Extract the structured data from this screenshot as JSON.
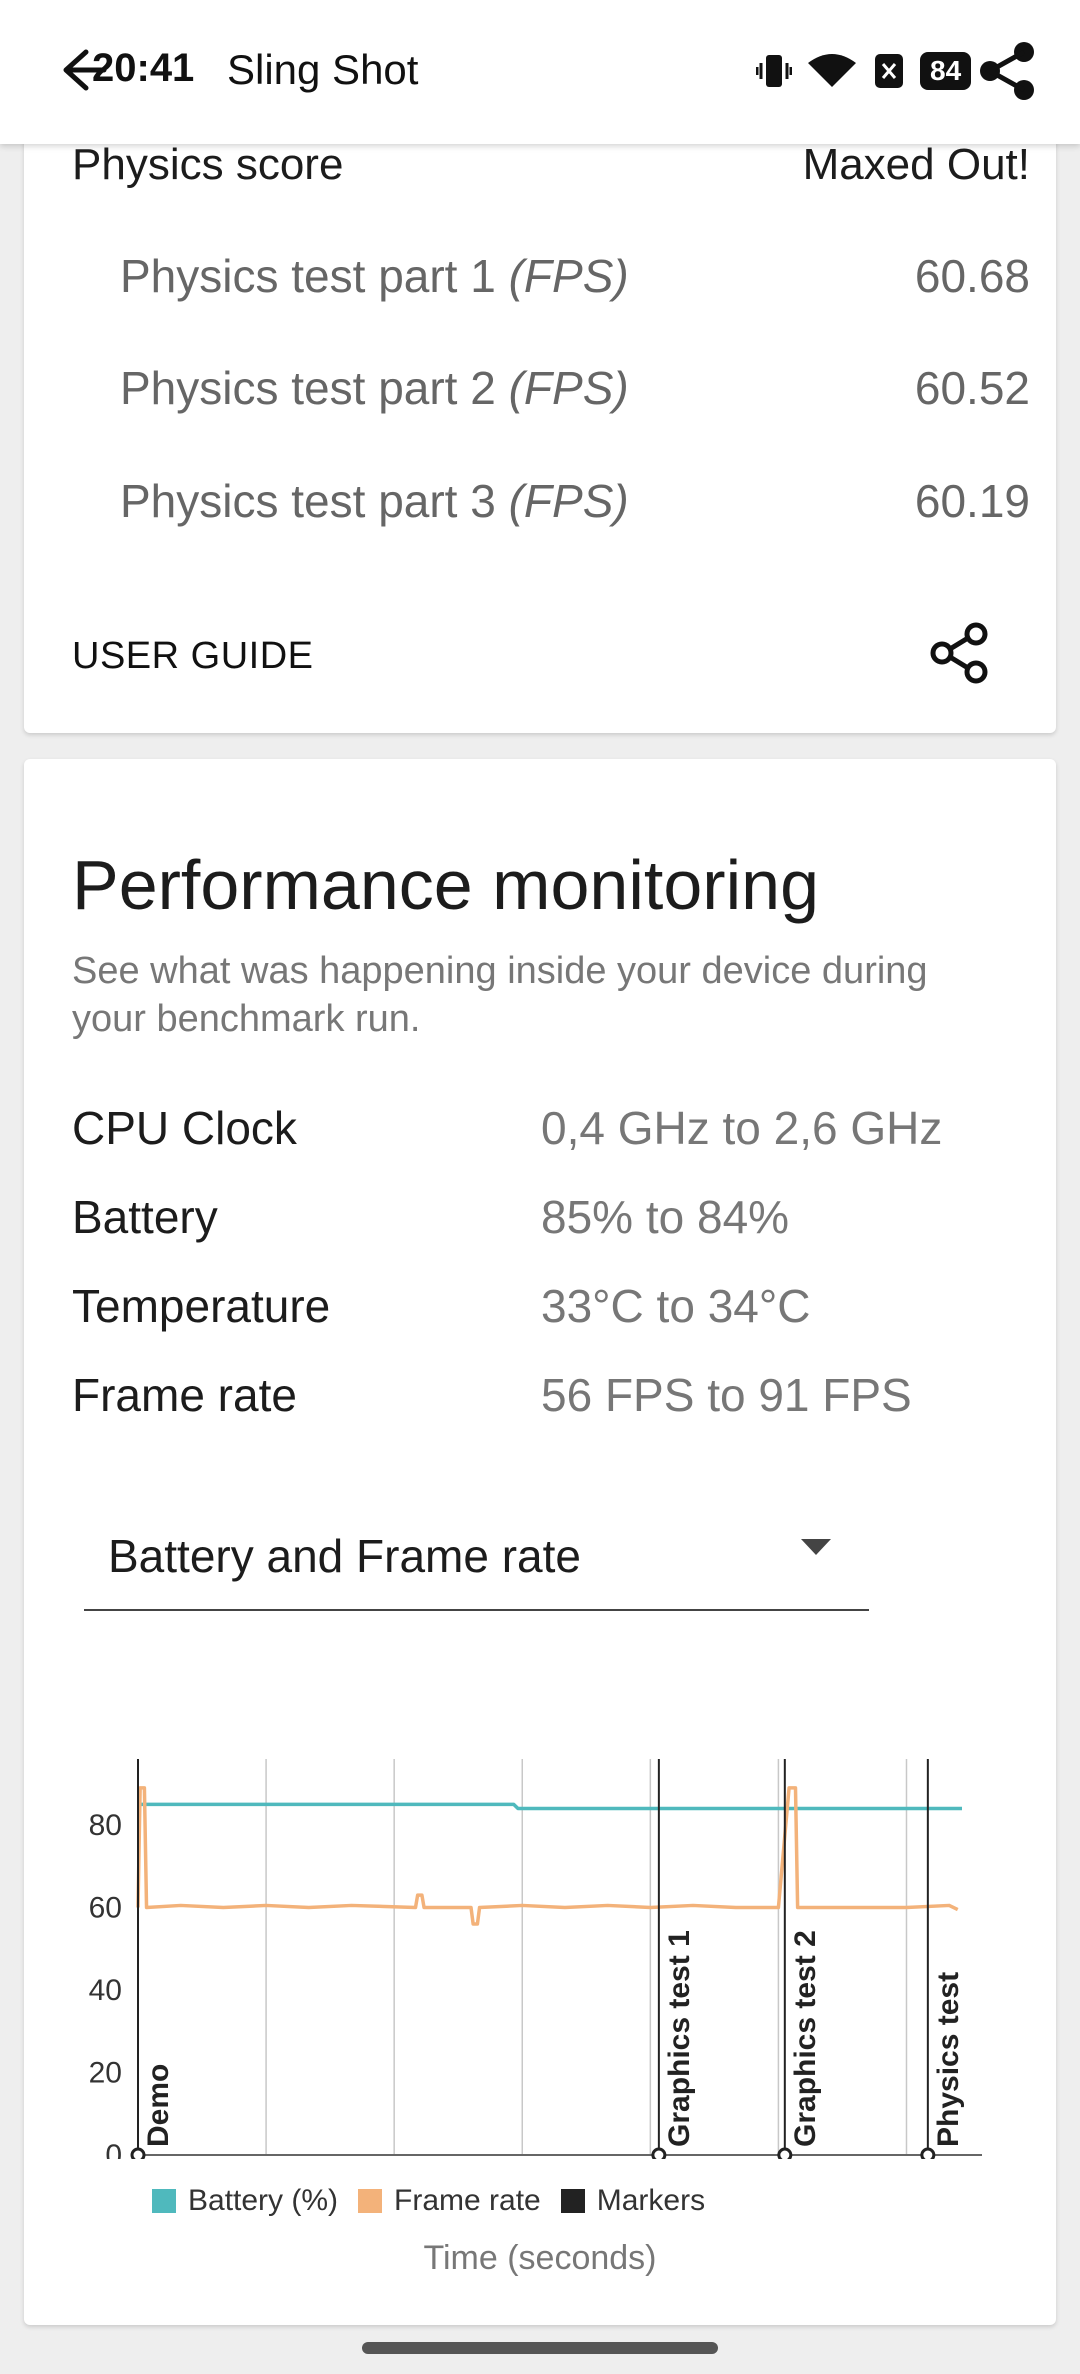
{
  "status_bar": {
    "time": "20:41",
    "battery": "84"
  },
  "appbar": {
    "title": "Sling Shot"
  },
  "scores": {
    "physics_label": "Physics score",
    "physics_value": "Maxed Out!",
    "parts": [
      {
        "label": "Physics test part 1",
        "unit": "(FPS)",
        "value": "60.68"
      },
      {
        "label": "Physics test part 2",
        "unit": "(FPS)",
        "value": "60.52"
      },
      {
        "label": "Physics test part 3",
        "unit": "(FPS)",
        "value": "60.19"
      }
    ],
    "user_guide": "USER GUIDE"
  },
  "performance": {
    "title": "Performance monitoring",
    "description": "See what was happening inside your device during your benchmark run.",
    "metrics": [
      {
        "label": "CPU Clock",
        "value": "0,4 GHz to 2,6 GHz"
      },
      {
        "label": "Battery",
        "value": "85% to 84%"
      },
      {
        "label": "Temperature",
        "value": "33°C to 34°C"
      },
      {
        "label": "Frame rate",
        "value": "56 FPS to 91 FPS"
      }
    ],
    "dropdown": {
      "selected": "Battery and Frame rate"
    }
  },
  "legend": {
    "battery": "Battery (%)",
    "frame_rate": "Frame rate",
    "markers": "Markers"
  },
  "colors": {
    "battery": "#4fb9bd",
    "frame_rate": "#f3b27a",
    "markers": "#222222"
  },
  "chart_data": {
    "type": "line",
    "xlabel": "Time (seconds)",
    "xlim": [
      0,
      193
    ],
    "ylim": [
      0,
      96
    ],
    "x_ticks": [
      "0",
      "30",
      "60",
      "90",
      "120",
      "150",
      "180"
    ],
    "y_ticks": [
      "0",
      "20",
      "40",
      "60",
      "80"
    ],
    "grid": true,
    "series": [
      {
        "name": "Battery (%)",
        "x": [
          0,
          88,
          89,
          193
        ],
        "values": [
          85,
          85,
          84,
          84
        ]
      },
      {
        "name": "Frame rate",
        "x": [
          0,
          0.5,
          1.5,
          2,
          10,
          20,
          30,
          40,
          50,
          65,
          65.5,
          66.5,
          67,
          78,
          78.5,
          79.5,
          80,
          90,
          100,
          110,
          120,
          130,
          140,
          150,
          152.5,
          153,
          154,
          154.5,
          160,
          170,
          180,
          190,
          192
        ],
        "values": [
          60,
          89,
          89,
          60,
          60.5,
          60,
          60.5,
          60,
          60.5,
          60,
          63,
          63,
          60,
          60,
          56,
          56,
          60,
          60.5,
          60,
          60.5,
          60,
          60.5,
          60,
          60,
          89,
          89,
          89,
          60,
          60,
          60,
          60,
          60.5,
          59.5
        ]
      }
    ],
    "markers": [
      {
        "x": 0,
        "label": "Demo"
      },
      {
        "x": 122,
        "label": "Graphics test 1"
      },
      {
        "x": 151.5,
        "label": "Graphics test 2"
      },
      {
        "x": 185,
        "label": "Physics test"
      }
    ]
  }
}
